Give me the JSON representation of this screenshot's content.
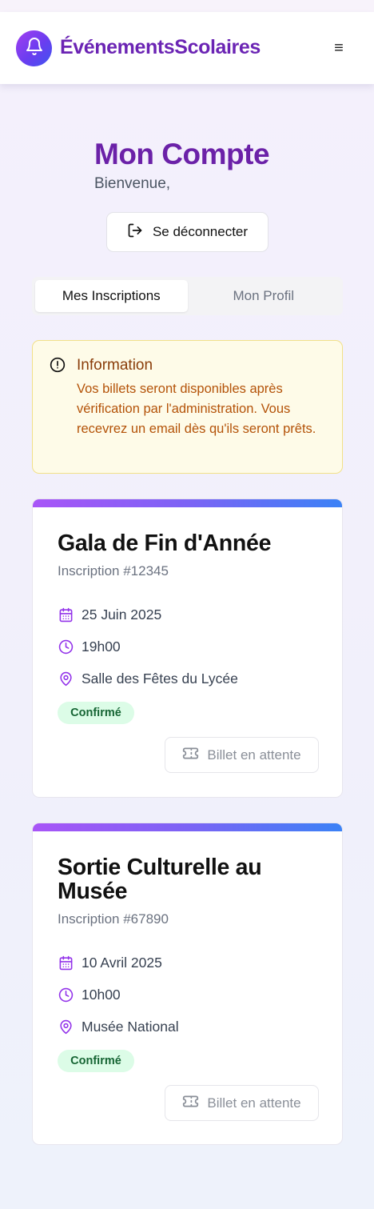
{
  "header": {
    "brand_icon": "bell-icon",
    "brand_title": "ÉvénementsScolaires",
    "menu_icon": "hamburger-menu-icon",
    "menu_glyph": "≡"
  },
  "account": {
    "title": "Mon Compte",
    "welcome": "Bienvenue,",
    "logout_label": "Se déconnecter",
    "logout_icon": "logout-icon"
  },
  "tabs": [
    {
      "label": "Mes Inscriptions",
      "active": true
    },
    {
      "label": "Mon Profil",
      "active": false
    }
  ],
  "info": {
    "icon": "alert-circle-icon",
    "title": "Information",
    "text": "Vos billets seront disponibles après vérification par l'administration. Vous recevrez un email dès qu'ils seront prêts."
  },
  "registrations": [
    {
      "title": "Gala de Fin d'Année",
      "number": "Inscription #12345",
      "date": "25 Juin 2025",
      "time": "19h00",
      "location": "Salle des Fêtes du Lycée",
      "status": "Confirmé",
      "ticket_label": "Billet en attente"
    },
    {
      "title": "Sortie Culturelle au Musée",
      "number": "Inscription #67890",
      "date": "10 Avril 2025",
      "time": "10h00",
      "location": "Musée National",
      "status": "Confirmé",
      "ticket_label": "Billet en attente"
    }
  ],
  "colors": {
    "brand": "#6b24b4",
    "accent_gradient_start": "#a855f7",
    "accent_gradient_end": "#3b82f6",
    "status_confirmed_bg": "#dcfce7",
    "status_confirmed_text": "#166534",
    "info_text": "#b45309"
  }
}
